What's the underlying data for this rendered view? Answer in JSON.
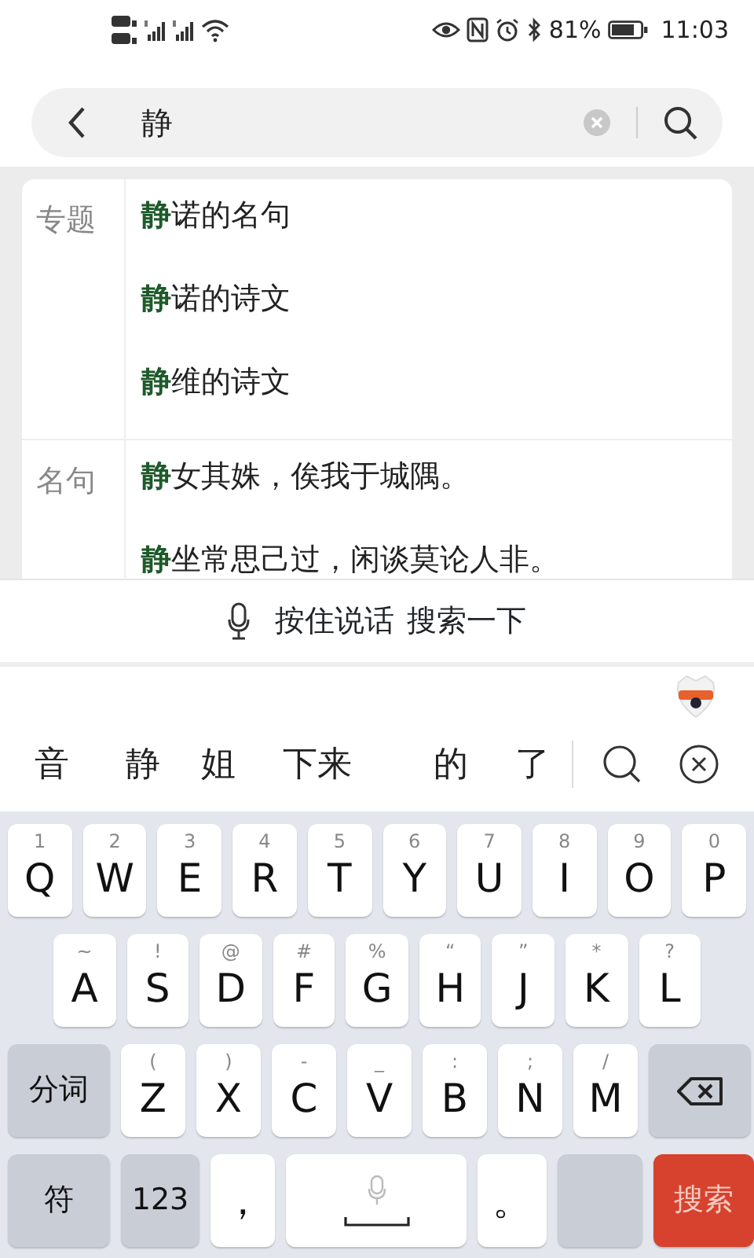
{
  "status_bar": {
    "battery": "81%",
    "time": "11:03"
  },
  "search": {
    "value": "静"
  },
  "sections": [
    {
      "label": "专题",
      "items": [
        {
          "match": "静",
          "rest": "诺的名句"
        },
        {
          "match": "静",
          "rest": "诺的诗文"
        },
        {
          "match": "静",
          "rest": "维的诗文"
        }
      ]
    },
    {
      "label": "名句",
      "items": [
        {
          "match": "静",
          "rest": "女其姝，俟我于城隅。"
        },
        {
          "match": "静",
          "rest": "坐常思己过，闲谈莫论人非。"
        }
      ]
    }
  ],
  "voice_bar": {
    "label": "按住说话",
    "action": "搜索一下"
  },
  "candidates": [
    "音",
    "静",
    "姐",
    "下来",
    "的",
    "了"
  ],
  "keyboard": [
    [
      {
        "kind": "letter",
        "label": "Q",
        "hint": "1"
      },
      {
        "kind": "letter",
        "label": "W",
        "hint": "2"
      },
      {
        "kind": "letter",
        "label": "E",
        "hint": "3"
      },
      {
        "kind": "letter",
        "label": "R",
        "hint": "4"
      },
      {
        "kind": "letter",
        "label": "T",
        "hint": "5"
      },
      {
        "kind": "letter",
        "label": "Y",
        "hint": "6"
      },
      {
        "kind": "letter",
        "label": "U",
        "hint": "7"
      },
      {
        "kind": "letter",
        "label": "I",
        "hint": "8"
      },
      {
        "kind": "letter",
        "label": "O",
        "hint": "9"
      },
      {
        "kind": "letter",
        "label": "P",
        "hint": "0"
      }
    ],
    [
      {
        "kind": "letter",
        "label": "A",
        "hint": "~"
      },
      {
        "kind": "letter",
        "label": "S",
        "hint": "!"
      },
      {
        "kind": "letter",
        "label": "D",
        "hint": "@"
      },
      {
        "kind": "letter",
        "label": "F",
        "hint": "#"
      },
      {
        "kind": "letter",
        "label": "G",
        "hint": "%"
      },
      {
        "kind": "letter",
        "label": "H",
        "hint": "“"
      },
      {
        "kind": "letter",
        "label": "J",
        "hint": "”"
      },
      {
        "kind": "letter",
        "label": "K",
        "hint": "*"
      },
      {
        "kind": "letter",
        "label": "L",
        "hint": "?"
      }
    ],
    [
      {
        "kind": "function",
        "label": "分词"
      },
      {
        "kind": "letter",
        "label": "Z",
        "hint": "("
      },
      {
        "kind": "letter",
        "label": "X",
        "hint": ")"
      },
      {
        "kind": "letter",
        "label": "C",
        "hint": "-"
      },
      {
        "kind": "letter",
        "label": "V",
        "hint": "_"
      },
      {
        "kind": "letter",
        "label": "B",
        "hint": ":"
      },
      {
        "kind": "letter",
        "label": "N",
        "hint": ";"
      },
      {
        "kind": "letter",
        "label": "M",
        "hint": "/"
      },
      {
        "kind": "backspace"
      }
    ],
    [
      {
        "kind": "function",
        "label": "符"
      },
      {
        "kind": "function",
        "label": "123"
      },
      {
        "kind": "punct",
        "label": "，"
      },
      {
        "kind": "space"
      },
      {
        "kind": "punct",
        "label": "。"
      },
      {
        "kind": "switch"
      },
      {
        "kind": "action",
        "label": "搜索"
      }
    ]
  ]
}
